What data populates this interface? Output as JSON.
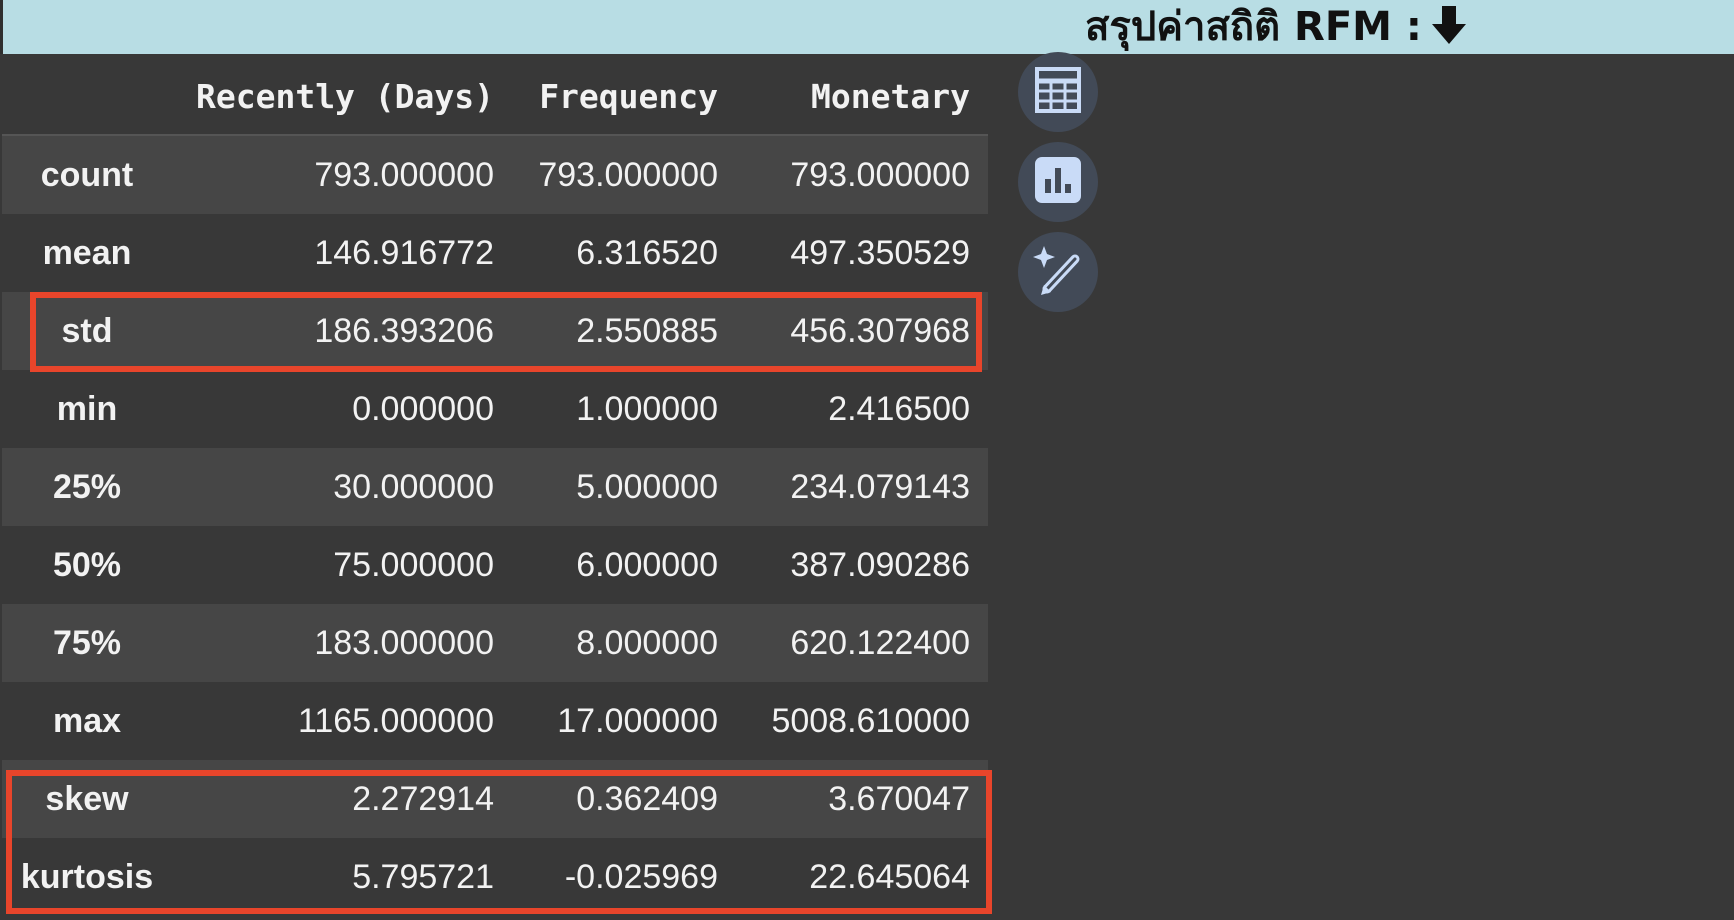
{
  "banner": {
    "title": "สรุปค่าสถิติ RFM :"
  },
  "table": {
    "columns": [
      "",
      "Recently (Days)",
      "Frequency",
      "Monetary"
    ],
    "rows": [
      {
        "index": "count",
        "values": [
          "793.000000",
          "793.000000",
          "793.000000"
        ]
      },
      {
        "index": "mean",
        "values": [
          "146.916772",
          "6.316520",
          "497.350529"
        ]
      },
      {
        "index": "std",
        "values": [
          "186.393206",
          "2.550885",
          "456.307968"
        ]
      },
      {
        "index": "min",
        "values": [
          "0.000000",
          "1.000000",
          "2.416500"
        ]
      },
      {
        "index": "25%",
        "values": [
          "30.000000",
          "5.000000",
          "234.079143"
        ]
      },
      {
        "index": "50%",
        "values": [
          "75.000000",
          "6.000000",
          "387.090286"
        ]
      },
      {
        "index": "75%",
        "values": [
          "183.000000",
          "8.000000",
          "620.122400"
        ]
      },
      {
        "index": "max",
        "values": [
          "1165.000000",
          "17.000000",
          "5008.610000"
        ]
      },
      {
        "index": "skew",
        "values": [
          "2.272914",
          "0.362409",
          "3.670047"
        ]
      },
      {
        "index": "kurtosis",
        "values": [
          "5.795721",
          "-0.025969",
          "22.645064"
        ]
      }
    ]
  },
  "icons": {
    "table": "table-icon",
    "chart": "bar-chart-icon",
    "magic": "magic-pen-icon",
    "arrow": "down-arrow-icon"
  },
  "colors": {
    "background": "#383838",
    "banner": "#b8dde4",
    "highlight": "#e8452b",
    "icon_button": "#424a57",
    "icon_fg": "#c9dbf7"
  }
}
